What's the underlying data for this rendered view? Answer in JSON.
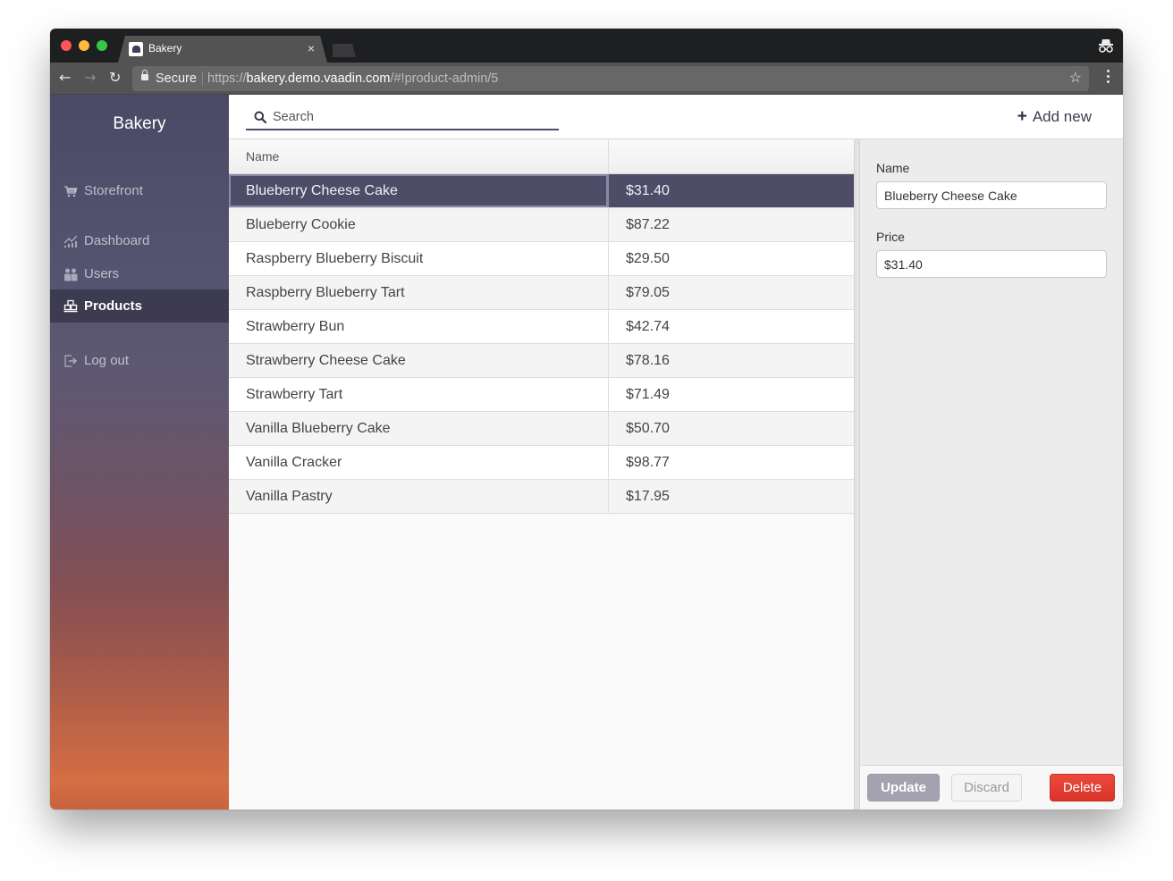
{
  "browser": {
    "tab_title": "Bakery",
    "tab_close": "×",
    "secure_label": "Secure",
    "url_scheme": "https://",
    "url_host": "bakery.demo.vaadin.com",
    "url_path": "/#!product-admin/5",
    "back": "←",
    "forward": "→",
    "reload": "↻",
    "bookmark": "☆"
  },
  "sidebar": {
    "brand": "Bakery",
    "items": [
      {
        "label": "Storefront",
        "icon": "cart-icon",
        "active": false
      },
      {
        "label": "Dashboard",
        "icon": "chart-icon",
        "active": false
      },
      {
        "label": "Users",
        "icon": "users-icon",
        "active": false
      },
      {
        "label": "Products",
        "icon": "products-icon",
        "active": true
      },
      {
        "label": "Log out",
        "icon": "logout-icon",
        "active": false
      }
    ]
  },
  "topbar": {
    "search_placeholder": "Search",
    "search_value": "",
    "add_new_icon": "+",
    "add_new_label": "Add new"
  },
  "grid": {
    "columns": [
      "Name",
      ""
    ],
    "selected_index": 0,
    "rows": [
      {
        "name": "Blueberry Cheese Cake",
        "price": "$31.40"
      },
      {
        "name": "Blueberry Cookie",
        "price": "$87.22"
      },
      {
        "name": "Raspberry Blueberry Biscuit",
        "price": "$29.50"
      },
      {
        "name": "Raspberry Blueberry Tart",
        "price": "$79.05"
      },
      {
        "name": "Strawberry Bun",
        "price": "$42.74"
      },
      {
        "name": "Strawberry Cheese Cake",
        "price": "$78.16"
      },
      {
        "name": "Strawberry Tart",
        "price": "$71.49"
      },
      {
        "name": "Vanilla Blueberry Cake",
        "price": "$50.70"
      },
      {
        "name": "Vanilla Cracker",
        "price": "$98.77"
      },
      {
        "name": "Vanilla Pastry",
        "price": "$17.95"
      }
    ]
  },
  "form": {
    "name_label": "Name",
    "name_value": "Blueberry Cheese Cake",
    "price_label": "Price",
    "price_value": "$31.40",
    "update_label": "Update",
    "discard_label": "Discard",
    "delete_label": "Delete"
  },
  "colors": {
    "accent": "#4d4d68",
    "delete": "#e53d32",
    "update_disabled": "#a3a3b0"
  }
}
